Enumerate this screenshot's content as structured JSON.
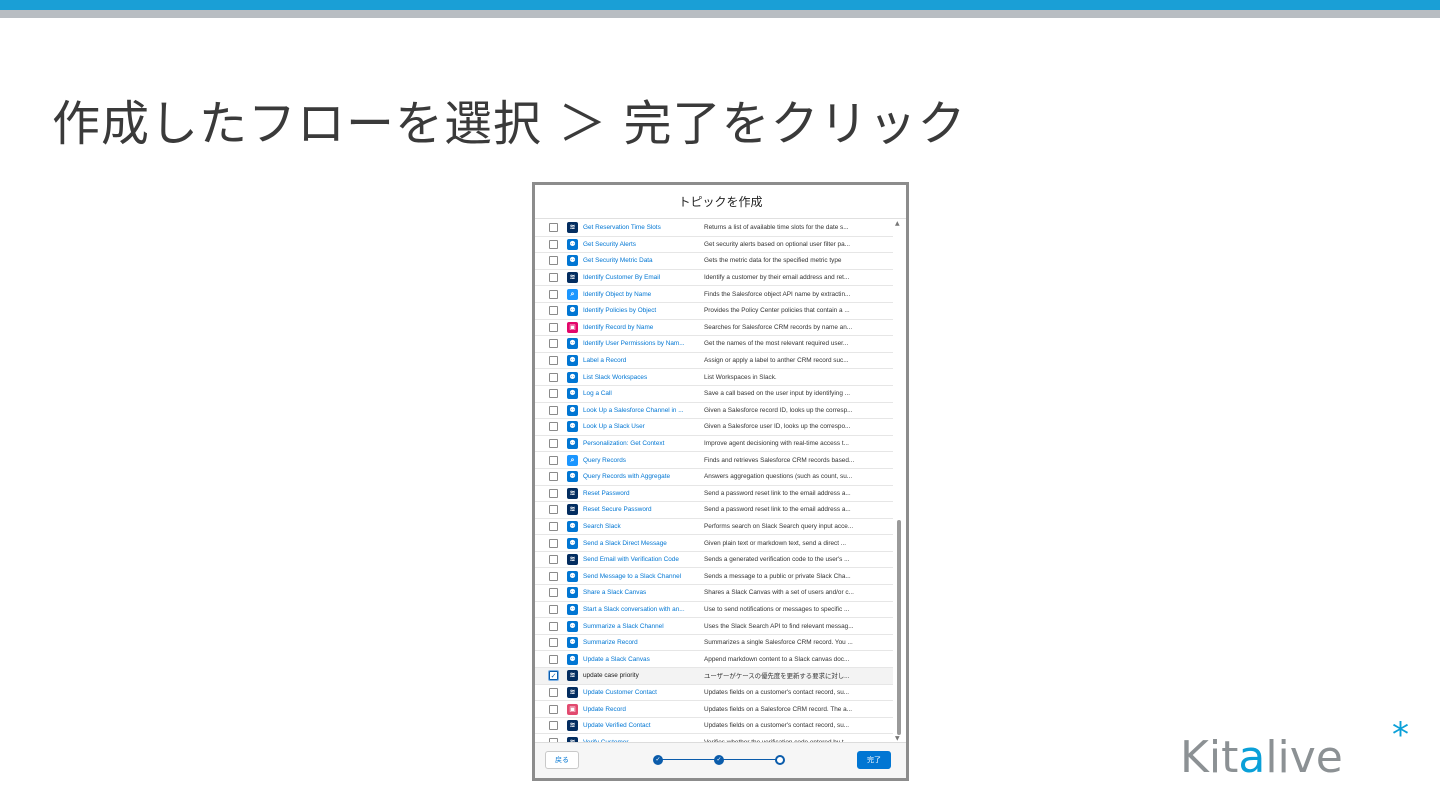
{
  "slide": {
    "title": "作成したフローを選択 ＞ 完了をクリック"
  },
  "modal": {
    "title": "トピックを作成",
    "back_label": "戻る",
    "done_label": "完了",
    "rows": [
      {
        "icon": "flow",
        "name": "Get Reservation Time Slots",
        "desc": "Returns a list of available time slots for the date s...",
        "checked": false
      },
      {
        "icon": "agent",
        "name": "Get Security Alerts",
        "desc": "Get security alerts based on optional user filter pa...",
        "checked": false
      },
      {
        "icon": "agent",
        "name": "Get Security Metric Data",
        "desc": "Gets the metric data for the specified metric type",
        "checked": false
      },
      {
        "icon": "flow",
        "name": "Identify Customer By Email",
        "desc": "Identify a customer by their email address and ret...",
        "checked": false
      },
      {
        "icon": "search",
        "name": "Identify Object by Name",
        "desc": "Finds the Salesforce object API name by extractin...",
        "checked": false
      },
      {
        "icon": "agent",
        "name": "Identify Policies by Object",
        "desc": "Provides the Policy Center policies that contain a ...",
        "checked": false
      },
      {
        "icon": "record",
        "name": "Identify Record by Name",
        "desc": "Searches for Salesforce CRM records by name an...",
        "checked": false
      },
      {
        "icon": "agent",
        "name": "Identify User Permissions by Nam...",
        "desc": "Get the names of the most relevant required user...",
        "checked": false
      },
      {
        "icon": "agent",
        "name": "Label a Record",
        "desc": "Assign or apply a label to anther CRM record suc...",
        "checked": false
      },
      {
        "icon": "agent",
        "name": "List Slack Workspaces",
        "desc": "List Workspaces in Slack.",
        "checked": false
      },
      {
        "icon": "agent",
        "name": "Log a Call",
        "desc": "Save a call based on the user input by identifying ...",
        "checked": false
      },
      {
        "icon": "agent",
        "name": "Look Up a Salesforce Channel in ...",
        "desc": "Given a Salesforce record ID, looks up the corresp...",
        "checked": false
      },
      {
        "icon": "agent",
        "name": "Look Up a Slack User",
        "desc": "Given a Salesforce user ID, looks up the correspo...",
        "checked": false
      },
      {
        "icon": "agent",
        "name": "Personalization: Get Context",
        "desc": "Improve agent decisioning with real-time access t...",
        "checked": false
      },
      {
        "icon": "search",
        "name": "Query Records",
        "desc": "Finds and retrieves Salesforce CRM records based...",
        "checked": false
      },
      {
        "icon": "agent",
        "name": "Query Records with Aggregate",
        "desc": "Answers aggregation questions (such as count, su...",
        "checked": false
      },
      {
        "icon": "flow",
        "name": "Reset Password",
        "desc": "Send a password reset link to the email address a...",
        "checked": false
      },
      {
        "icon": "flow",
        "name": "Reset Secure Password",
        "desc": "Send a password reset link to the email address a...",
        "checked": false
      },
      {
        "icon": "agent",
        "name": "Search Slack",
        "desc": "Performs search on Slack Search query input acce...",
        "checked": false
      },
      {
        "icon": "agent",
        "name": "Send a Slack Direct Message",
        "desc": "Given plain text or markdown text, send a direct ...",
        "checked": false
      },
      {
        "icon": "flow",
        "name": "Send Email with Verification Code",
        "desc": "Sends a generated verification code to the user's ...",
        "checked": false
      },
      {
        "icon": "agent",
        "name": "Send Message to a Slack Channel",
        "desc": "Sends a message to a public or private Slack Cha...",
        "checked": false
      },
      {
        "icon": "agent",
        "name": "Share a Slack Canvas",
        "desc": "Shares a Slack Canvas with a set of users and/or c...",
        "checked": false
      },
      {
        "icon": "agent",
        "name": "Start a Slack conversation with an...",
        "desc": "Use to send notifications or messages to specific ...",
        "checked": false
      },
      {
        "icon": "agent",
        "name": "Summarize a Slack Channel",
        "desc": "Uses the Slack Search API to find relevant messag...",
        "checked": false
      },
      {
        "icon": "agent",
        "name": "Summarize Record",
        "desc": "Summarizes a single Salesforce CRM record. You ...",
        "checked": false
      },
      {
        "icon": "agent",
        "name": "Update a Slack Canvas",
        "desc": "Append markdown content to a Slack canvas doc...",
        "checked": false
      },
      {
        "icon": "flow",
        "name": "update case priority",
        "desc": "ユーザーがケースの優先度を更新する要求に対し...",
        "checked": true
      },
      {
        "icon": "flow",
        "name": "Update Customer Contact",
        "desc": "Updates fields on a customer's contact record, su...",
        "checked": false
      },
      {
        "icon": "record2",
        "name": "Update Record",
        "desc": "Updates fields on a Salesforce CRM record. The a...",
        "checked": false
      },
      {
        "icon": "flow",
        "name": "Update Verified Contact",
        "desc": "Updates fields on a customer's contact record, su...",
        "checked": false
      },
      {
        "icon": "flow",
        "name": "Verify Customer",
        "desc": "Verifies whether the verification code entered by t...",
        "checked": false
      }
    ],
    "progress": {
      "steps": 3,
      "completed": 2
    }
  },
  "logo": {
    "text_gray_1": "Kit",
    "text_blue": "a",
    "text_gray_2": "live",
    "star": "*"
  }
}
